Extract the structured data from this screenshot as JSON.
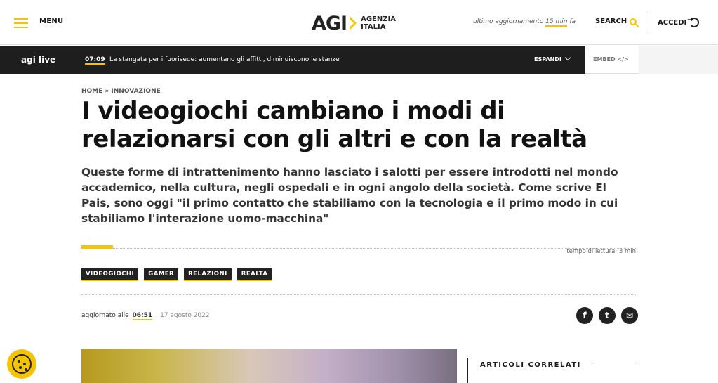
{
  "header": {
    "menu_label": "MENU",
    "logo_main": "AGI",
    "logo_line1": "AGENZIA",
    "logo_line2": "ITALIA",
    "update_prefix": "ultimo aggiornamento",
    "update_value": "15 min",
    "update_suffix": "fa",
    "search_label": "SEARCH",
    "login_label": "ACCEDI",
    "accent_color": "#f5c400"
  },
  "livebar": {
    "label": "agi live",
    "time": "07:09",
    "headline": "La stangata per i fuorisede: aumentano gli affitti, diminuiscono le stanze",
    "expand_label": "ESPANDI",
    "embed_label": "EMBED </>"
  },
  "article": {
    "breadcrumb": [
      "HOME",
      "INNOVAZIONE"
    ],
    "title": "I videogiochi cambiano i modi di relazionarsi con gli altri e con la realtà",
    "subtitle": "Queste forme di intrattenimento hanno lasciato i salotti per essere introdotti nel mondo accademico, nella cultura, negli ospedali e in ogni angolo della società. Come scrive El Pais, sono oggi \"il primo contatto che stabiliamo con la tecnologia e il primo modo in cui stabiliamo l'interazione uomo-macchina\"",
    "reading_progress": 0.057,
    "reading_time": "tempo di lettura: 3 min",
    "tags": [
      "VIDEOGIOCHI",
      "GAMER",
      "RELAZIONI",
      "REALTA"
    ],
    "updated_prefix": "aggiornato alle",
    "updated_time": "06:51",
    "updated_date": "17 agosto 2022",
    "share": [
      {
        "icon": "facebook-icon",
        "glyph": "f"
      },
      {
        "icon": "twitter-icon",
        "glyph": "t"
      },
      {
        "icon": "email-icon",
        "glyph": "✉"
      }
    ]
  },
  "related": {
    "title": "ARTICOLI CORRELATI"
  },
  "cookie": {
    "icon": "cookie-icon"
  }
}
